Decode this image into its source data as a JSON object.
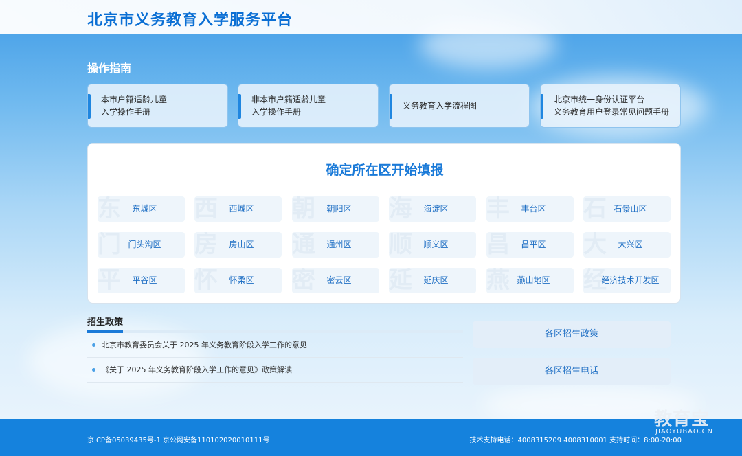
{
  "header": {
    "title": "北京市义务教育入学服务平台"
  },
  "guide": {
    "title": "操作指南",
    "cards": [
      {
        "line1": "本市户籍适龄儿童",
        "line2": "入学操作手册"
      },
      {
        "line1": "非本市户籍适龄儿童",
        "line2": "入学操作手册"
      },
      {
        "line1": "义务教育入学流程图",
        "line2": ""
      },
      {
        "line1": "北京市统一身份认证平台",
        "line2": "义务教育用户登录常见问题手册"
      }
    ]
  },
  "districts": {
    "heading": "确定所在区开始填报",
    "items": [
      {
        "name": "东城区",
        "watermark": "东"
      },
      {
        "name": "西城区",
        "watermark": "西"
      },
      {
        "name": "朝阳区",
        "watermark": "朝"
      },
      {
        "name": "海淀区",
        "watermark": "海"
      },
      {
        "name": "丰台区",
        "watermark": "丰"
      },
      {
        "name": "石景山区",
        "watermark": "石"
      },
      {
        "name": "门头沟区",
        "watermark": "门"
      },
      {
        "name": "房山区",
        "watermark": "房"
      },
      {
        "name": "通州区",
        "watermark": "通"
      },
      {
        "name": "顺义区",
        "watermark": "顺"
      },
      {
        "name": "昌平区",
        "watermark": "昌"
      },
      {
        "name": "大兴区",
        "watermark": "大"
      },
      {
        "name": "平谷区",
        "watermark": "平"
      },
      {
        "name": "怀柔区",
        "watermark": "怀"
      },
      {
        "name": "密云区",
        "watermark": "密"
      },
      {
        "name": "延庆区",
        "watermark": "延"
      },
      {
        "name": "燕山地区",
        "watermark": "燕"
      },
      {
        "name": "经济技术开发区",
        "watermark": "经"
      }
    ]
  },
  "policy": {
    "heading": "招生政策",
    "items": [
      "北京市教育委员会关于 2025 年义务教育阶段入学工作的意见",
      "《关于 2025 年义务教育阶段入学工作的意见》政策解读"
    ]
  },
  "side": {
    "policy_btn": "各区招生政策",
    "phone_btn": "各区招生电话"
  },
  "footer": {
    "icp": "京ICP备05039435号-1 京公网安备110102020010111号",
    "support": "技术支持电话：4008315209 4008310001 支持时间：8:00-20:00"
  },
  "watermark_logo": {
    "cn": "教育宝",
    "en": "JIAOYUBAO.CN"
  }
}
